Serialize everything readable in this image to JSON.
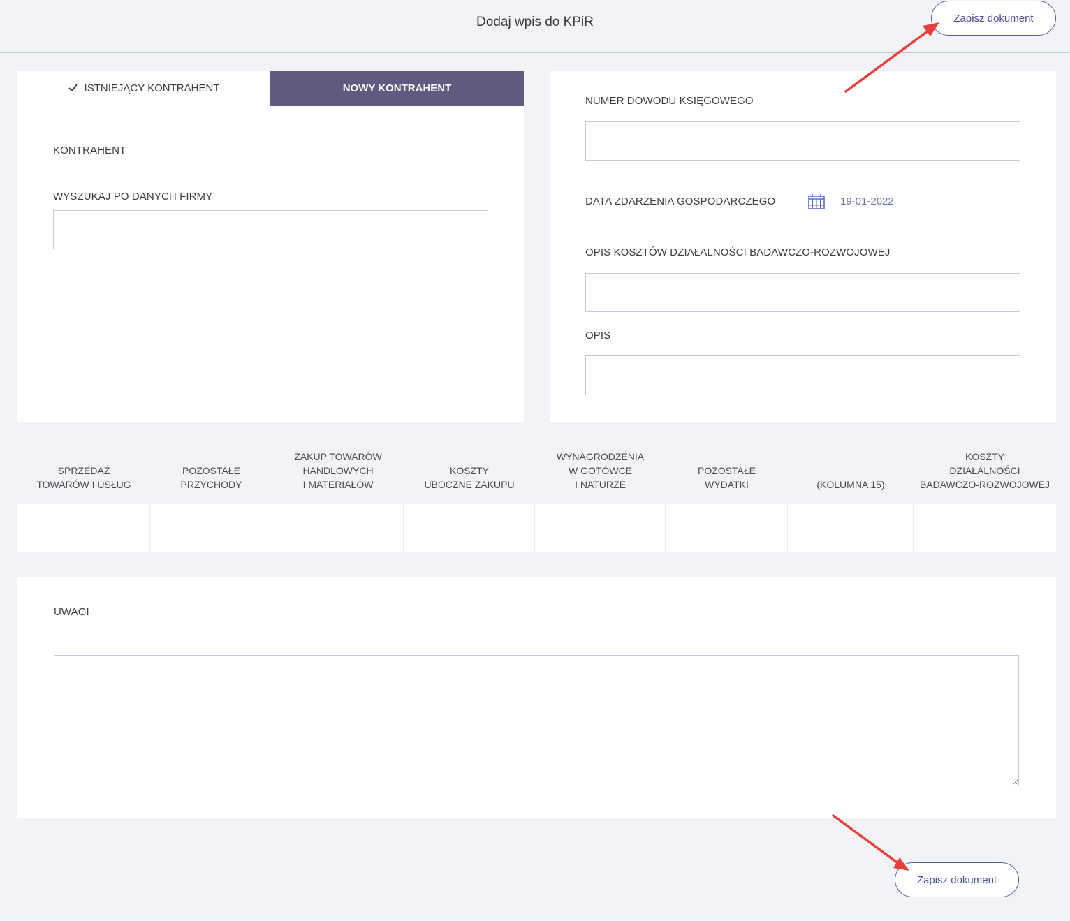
{
  "header": {
    "title": "Dodaj wpis do KPiR",
    "save_label": "Zapisz dokument"
  },
  "contractor": {
    "tabs": [
      {
        "label": "ISTNIEJĄCY KONTRAHENT",
        "active": true
      },
      {
        "label": "NOWY KONTRAHENT",
        "active": false
      }
    ],
    "section_label": "KONTRAHENT",
    "search_label": "WYSZUKAJ PO DANYCH FIRMY",
    "search_value": ""
  },
  "document": {
    "number_label": "NUMER DOWODU KSIĘGOWEGO",
    "number_value": "",
    "date_label": "DATA ZDARZENIA GOSPODARCZEGO",
    "date_value": "19-01-2022",
    "rd_label": "OPIS KOSZTÓW DZIAŁALNOŚCI BADAWCZO-ROZWOJOWEJ",
    "rd_value": "",
    "description_label": "OPIS",
    "description_value": ""
  },
  "columns": [
    {
      "lines": [
        "SPRZEDAŻ",
        "TOWARÓW I USŁUG"
      ]
    },
    {
      "lines": [
        "POZOSTAŁE",
        "PRZYCHODY"
      ]
    },
    {
      "lines": [
        "ZAKUP TOWARÓW",
        "HANDLOWYCH",
        "I MATERIAŁÓW"
      ]
    },
    {
      "lines": [
        "KOSZTY",
        "UBOCZNE ZAKUPU"
      ]
    },
    {
      "lines": [
        "WYNAGRODZENIA",
        "W GOTÓWCE",
        "I NATURZE"
      ]
    },
    {
      "lines": [
        "POZOSTAŁE",
        "WYDATKI"
      ]
    },
    {
      "lines": [
        "(KOLUMNA 15)"
      ]
    },
    {
      "lines": [
        "KOSZTY",
        "DZIAŁALNOŚCI",
        "BADAWCZO-ROZWOJOWEJ"
      ]
    }
  ],
  "notes": {
    "label": "UWAGI",
    "value": ""
  },
  "footer": {
    "save_label": "Zapisz dokument"
  },
  "colors": {
    "accent": "#5f5a80",
    "link": "#4a4f9e",
    "annotation_arrow": "#e8403d"
  }
}
